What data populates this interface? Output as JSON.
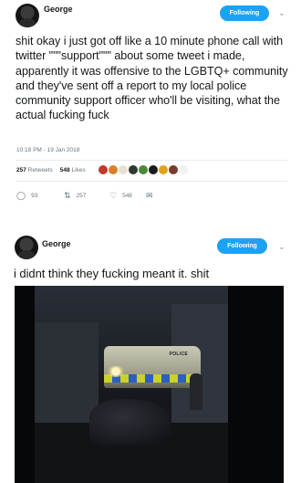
{
  "tweets": [
    {
      "author": "George",
      "follow_label": "Following",
      "text": "shit okay i just got off like a 10 minute phone call with twitter \"\"\"support\"\"\" about some tweet i made, apparently it was offensive to the LGBTQ+ community and they've sent off a report to my local police community support officer who'll be visiting, what the actual fucking fuck",
      "timestamp": "10:18 PM - 19 Jan 2018",
      "stats": {
        "retweets_count": "257",
        "retweets_label": "Retweets",
        "likes_count": "548",
        "likes_label": "Likes"
      },
      "actions": {
        "replies": "93",
        "retweets": "257",
        "likes": "548"
      }
    },
    {
      "author": "George",
      "follow_label": "Following",
      "text": "i didnt think they fucking meant it. shit",
      "video_van_text": "POLICE"
    }
  ],
  "icons": {
    "chevron": "chevron-down-icon",
    "reply": "reply-icon",
    "retweet": "retweet-icon",
    "like": "heart-icon",
    "message": "envelope-icon"
  },
  "colors": {
    "accent": "#1da1f2",
    "muted": "#657786",
    "text": "#14171a"
  }
}
